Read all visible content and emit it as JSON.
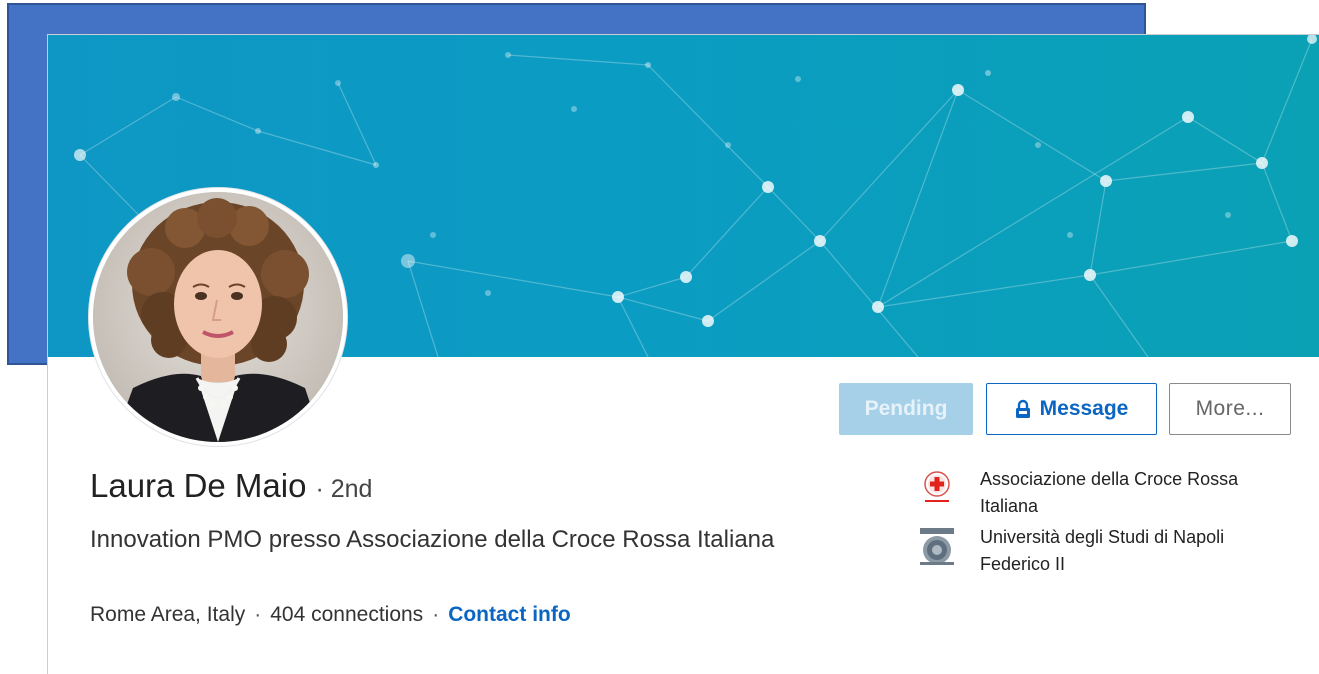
{
  "profile": {
    "name": "Laura De Maio",
    "degree": "· 2nd",
    "headline": "Innovation PMO presso Associazione della Croce Rossa Italiana",
    "location": "Rome Area, Italy",
    "separator": "·",
    "connections": "404 connections",
    "contact_info": "Contact info"
  },
  "actions": {
    "pending": "Pending",
    "message": "Message",
    "more": "More..."
  },
  "orgs": [
    {
      "name": "Associazione della Croce Rossa Italiana",
      "icon": "red-cross-logo"
    },
    {
      "name": "Università degli Studi di Napoli Federico II",
      "icon": "unina-logo"
    }
  ],
  "colors": {
    "banner_start": "#0e97c4",
    "banner_end": "#0aa1b5",
    "accent_blue": "#0a66c2",
    "pending_bg": "#a6cfe8",
    "back_frame": "#4472c4"
  }
}
